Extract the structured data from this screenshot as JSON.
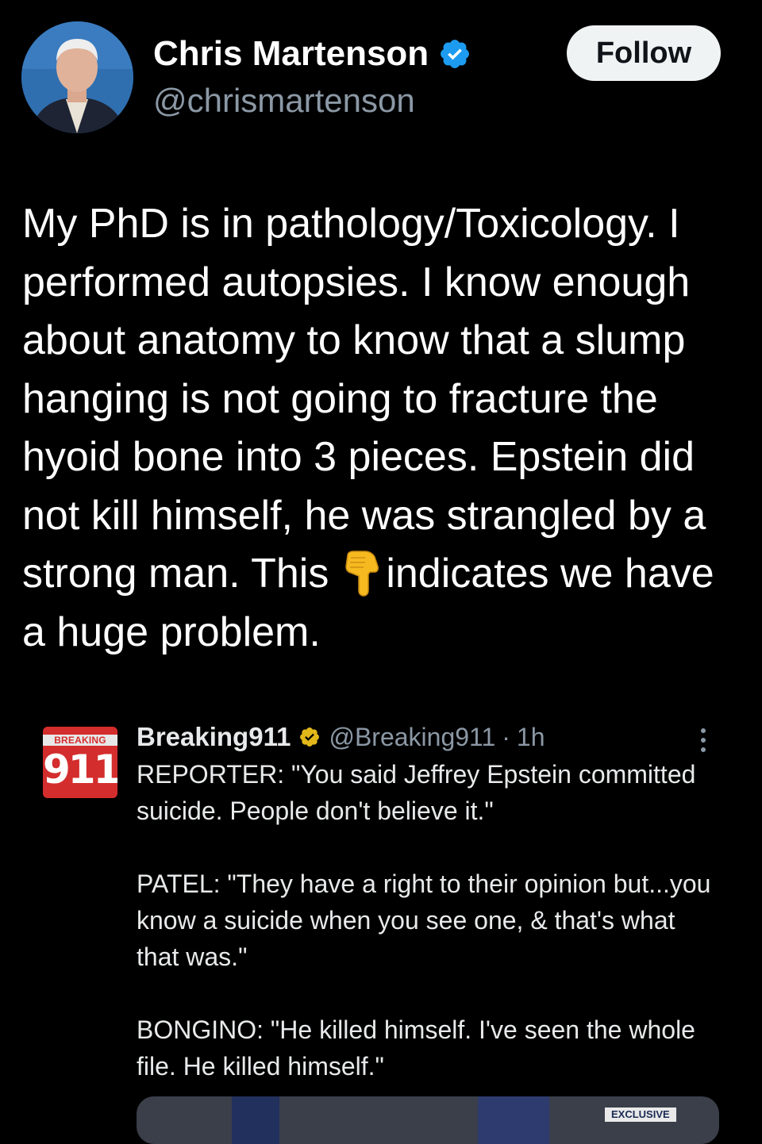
{
  "author": {
    "name": "Chris Martenson",
    "handle": "@chrismartenson",
    "verified": true
  },
  "follow_label": "Follow",
  "tweet": {
    "before_emoji": "My PhD is in pathology/Toxicology.  I performed autopsies.  I know enough about anatomy to know that a slump hanging is not going to fracture the hyoid bone into 3 pieces.  Epstein did not kill himself, he was strangled by a strong man.  This",
    "emoji": "backhand-index-pointing-down-icon",
    "after_emoji": "indicates we have a huge problem."
  },
  "quoted": {
    "logo_kicker": "BREAKING",
    "logo_number": "911",
    "name": "Breaking911",
    "handle": "@Breaking911",
    "separator": "·",
    "time": "1h",
    "paragraphs": [
      "REPORTER: \"You said Jeffrey Epstein committed suicide. People don't believe it.\"",
      "PATEL: \"They have a right to their opinion but...you know a suicide when you see one, & that's what that was.\"",
      "BONGINO: \"He killed himself. I've seen the whole file. He killed himself.\""
    ],
    "media_badge": "EXCLUSIVE"
  },
  "colors": {
    "background": "#000000",
    "verified_blue": "#1d9bf0",
    "gold_badge": "#e2b719",
    "secondary_text": "#8b98a5",
    "logo_red": "#d42d2d"
  }
}
